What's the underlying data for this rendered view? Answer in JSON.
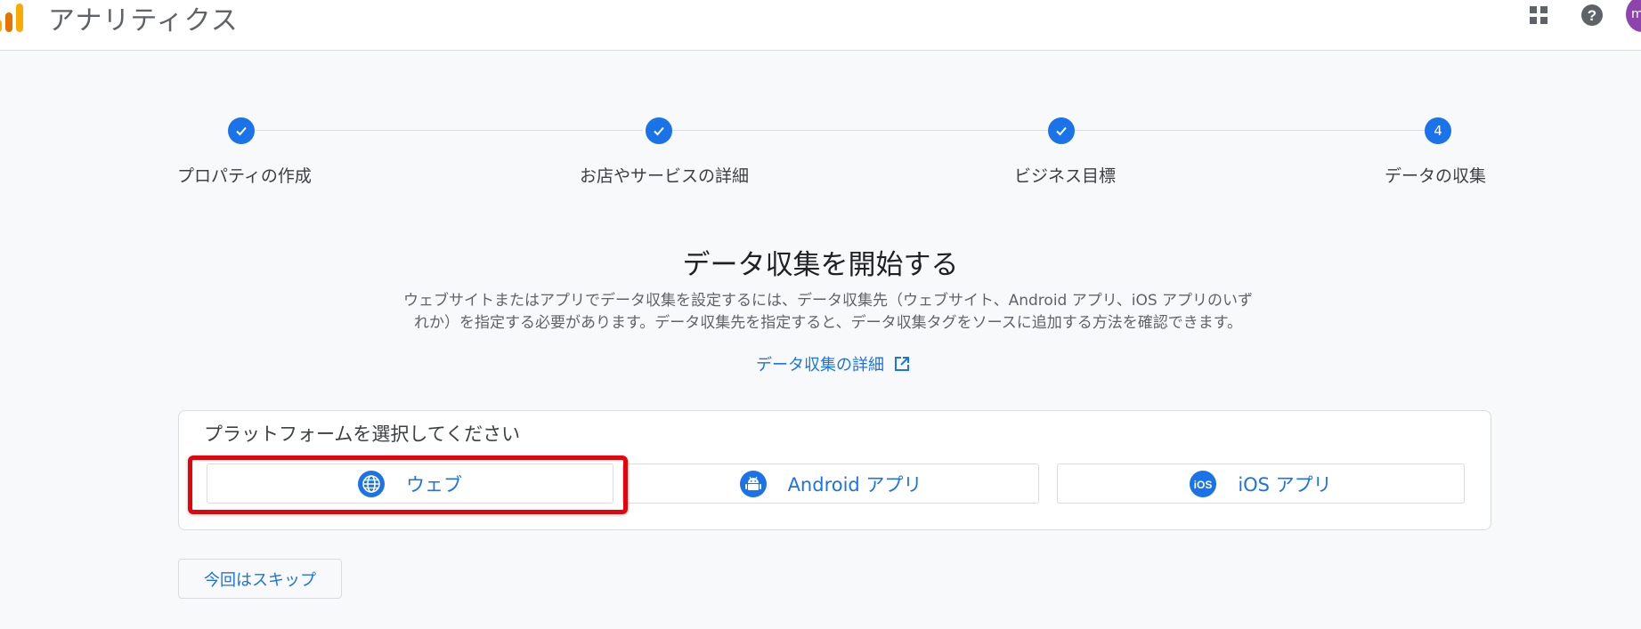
{
  "header": {
    "app_title": "アナリティクス",
    "avatar_letter": "m",
    "icons": [
      "analytics-logo-icon",
      "apps-grid-icon",
      "help-icon"
    ]
  },
  "stepper": {
    "steps": [
      {
        "label": "プロパティの作成",
        "status": "done"
      },
      {
        "label": "お店やサービスの詳細",
        "status": "done"
      },
      {
        "label": "ビジネス目標",
        "status": "done"
      },
      {
        "label": "データの収集",
        "status": "current",
        "number": "4"
      }
    ]
  },
  "main": {
    "title": "データ収集を開始する",
    "desc_line1": "ウェブサイトまたはアプリでデータ収集を設定するには、データ収集先（ウェブサイト、Android アプリ、iOS アプリのいず",
    "desc_line2": "れか）を指定する必要があります。データ収集先を指定すると、データ収集タグをソースに追加する方法を確認できます。",
    "detail_link": "データ収集の詳細"
  },
  "platform": {
    "heading": "プラットフォームを選択してください",
    "options": [
      {
        "label": "ウェブ",
        "icon": "globe-icon"
      },
      {
        "label": "Android アプリ",
        "icon": "android-icon"
      },
      {
        "label": "iOS アプリ",
        "icon": "ios-icon"
      }
    ]
  },
  "skip_label": "今回はスキップ",
  "colors": {
    "accent": "#1a73e8",
    "highlight": "#e5040b"
  }
}
